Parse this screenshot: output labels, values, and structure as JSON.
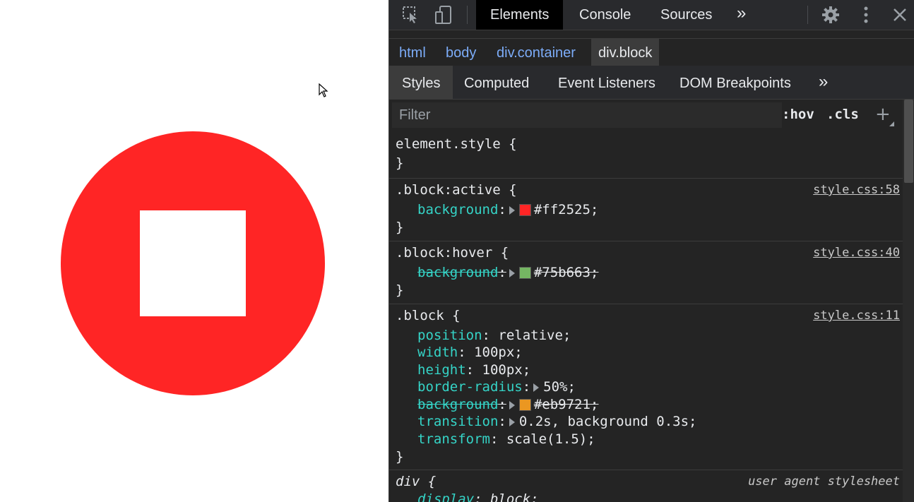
{
  "preview": {
    "circle_color": "#ff2525",
    "square_color": "#ffffff",
    "cursor_icon": "mouse-pointer-icon"
  },
  "toolbar": {
    "inspect_icon": "inspect-element-icon",
    "device_icon": "device-toolbar-icon",
    "tabs": [
      "Elements",
      "Console",
      "Sources"
    ],
    "more_tabs": "»",
    "settings_icon": "gear-icon",
    "menu_icon": "kebab-menu-icon",
    "close_icon": "close-icon"
  },
  "breadcrumbs": [
    "html",
    "body",
    "div.container",
    "div.block"
  ],
  "subtabs": [
    "Styles",
    "Computed",
    "Event Listeners",
    "DOM Breakpoints"
  ],
  "subtabs_more": "»",
  "filter": {
    "placeholder": "Filter",
    "hov": ":hov",
    "cls": ".cls",
    "add": "+"
  },
  "rules": {
    "element_style": {
      "selector": "element.style {",
      "close": "}"
    },
    "active": {
      "selector": ".block:active {",
      "source": "style.css:58",
      "prop": "background",
      "value": "#ff2525;",
      "swatch": "#ff2525",
      "close": "}"
    },
    "hover": {
      "selector": ".block:hover {",
      "source": "style.css:40",
      "prop": "background",
      "value": "#75b663;",
      "swatch": "#75b663",
      "close": "}"
    },
    "block": {
      "selector": ".block {",
      "source": "style.css:11",
      "position_prop": "position",
      "position_val": "relative;",
      "width_prop": "width",
      "width_val": "100px;",
      "height_prop": "height",
      "height_val": "100px;",
      "radius_prop": "border-radius",
      "radius_val": "50%;",
      "bg_prop": "background",
      "bg_val": "#eb9721;",
      "bg_swatch": "#eb9721",
      "transition_prop": "transition",
      "transition_val": "0.2s, background 0.3s;",
      "transform_prop": "transform",
      "transform_val": "scale(1.5);",
      "close": "}"
    },
    "div": {
      "selector": "div {",
      "source": "user agent stylesheet",
      "display_prop": "display",
      "display_val": "block;"
    }
  }
}
